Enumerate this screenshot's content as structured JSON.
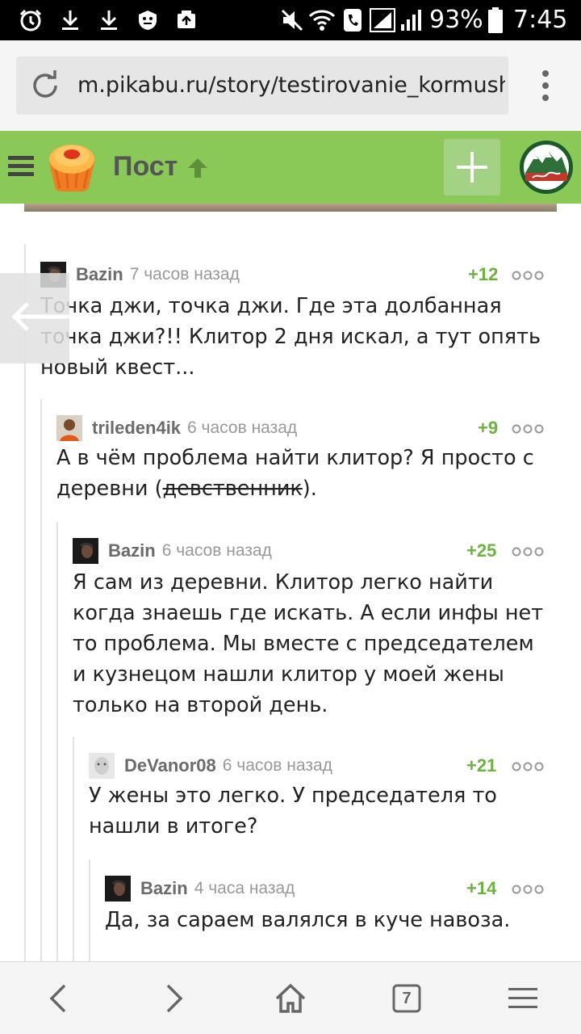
{
  "status_bar": {
    "battery": "93%",
    "time": "7:45"
  },
  "browser": {
    "url": "m.pikabu.ru/story/testirovanie_kormushki_",
    "tab_count": "7"
  },
  "header": {
    "title": "Пост"
  },
  "comments": [
    {
      "author": "Bazin",
      "time": "7 часов назад",
      "score": "+12",
      "text": "Точка джи, точка джи. Где эта долбанная точка джи?!! Клитор 2 дня искал, а тут опять новый квест..."
    },
    {
      "author": "trileden4ik",
      "time": "6 часов назад",
      "score": "+9",
      "text_before": "А в чём проблема найти клитор? Я просто с деревни (",
      "text_strike": "девственник",
      "text_after": ")."
    },
    {
      "author": "Bazin",
      "time": "6 часов назад",
      "score": "+25",
      "text": "Я сам из деревни. Клитор легко найти когда знаешь где искать. А если инфы нет то проблема. Мы вместе с председателем и кузнецом нашли клитор у моей жены только на второй день."
    },
    {
      "author": "DeVanor08",
      "time": "6 часов назад",
      "score": "+21",
      "text": "У жены это легко. У председателя то нашли в итоге?"
    },
    {
      "author": "Bazin",
      "time": "4 часа назад",
      "score": "+14",
      "text": "Да, за сараем валялся в куче навоза."
    }
  ],
  "colors": {
    "brand_green": "#8ac858",
    "score_green": "#6cb33e"
  },
  "icons": {
    "status_left": [
      "alarm-icon",
      "download-icon",
      "download-icon",
      "shield-app-icon",
      "photo-upload-icon"
    ],
    "status_right": [
      "mute-icon",
      "wifi-call-icon",
      "phone-icon",
      "signal-icon",
      "signal-icon",
      "battery-icon"
    ],
    "nav": [
      "back-icon",
      "forward-icon",
      "home-icon",
      "tabs-icon",
      "menu-icon"
    ]
  }
}
